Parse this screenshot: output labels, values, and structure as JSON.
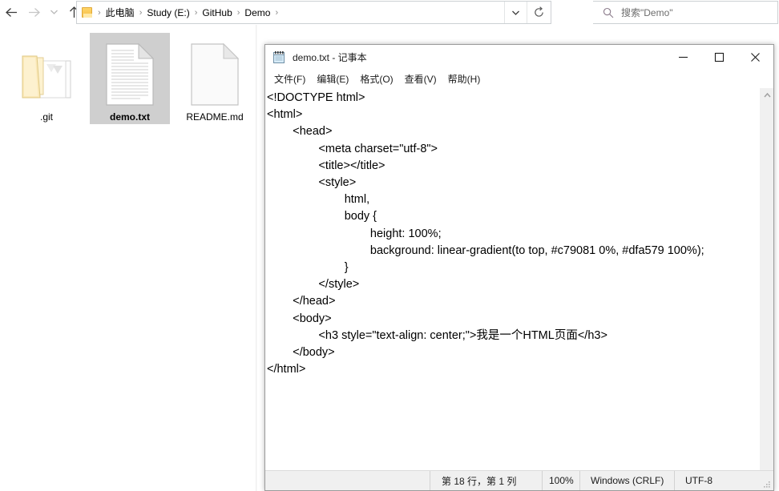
{
  "explorer": {
    "nav": {
      "back_icon": "arrow-left-icon",
      "forward_icon": "arrow-right-icon",
      "recent_icon": "chevron-down-icon",
      "up_icon": "arrow-up-icon"
    },
    "breadcrumb": {
      "folder_icon": "folder-icon",
      "items": [
        "此电脑",
        "Study (E:)",
        "GitHub",
        "Demo"
      ],
      "separator": "›",
      "dropdown_icon": "chevron-down-icon",
      "refresh_icon": "refresh-icon"
    },
    "search": {
      "icon": "search-icon",
      "placeholder": "搜索\"Demo\""
    },
    "files": [
      {
        "name": ".git",
        "icon": "folder-icon",
        "selected": false
      },
      {
        "name": "demo.txt",
        "icon": "text-file-icon",
        "selected": true
      },
      {
        "name": "README.md",
        "icon": "blank-file-icon",
        "selected": false
      }
    ]
  },
  "notepad": {
    "icon": "notepad-icon",
    "title": "demo.txt - 记事本",
    "controls": {
      "minimize": "—",
      "maximize": "☐",
      "close": "✕",
      "minimize_name": "minimize-button",
      "maximize_name": "maximize-button",
      "close_name": "close-button"
    },
    "menu": [
      "文件(F)",
      "编辑(E)",
      "格式(O)",
      "查看(V)",
      "帮助(H)"
    ],
    "document_text": "<!DOCTYPE html>\n<html>\n\t<head>\n\t\t<meta charset=\"utf-8\">\n\t\t<title></title>\n\t\t<style>\n\t\t\thtml,\n\t\t\tbody {\n\t\t\t\theight: 100%;\n\t\t\t\tbackground: linear-gradient(to top, #c79081 0%, #dfa579 100%);\n\t\t\t}\n\t\t</style>\n\t</head>\n\t<body>\n\t\t<h3 style=\"text-align: center;\">我是一个HTML页面</h3>\n\t</body>\n</html>",
    "scrollbar": {
      "up_icon": "chevron-up-icon",
      "down_icon": "chevron-down-icon"
    },
    "statusbar": {
      "position": "第 18 行，第 1 列",
      "zoom": "100%",
      "line_ending": "Windows (CRLF)",
      "encoding": "UTF-8",
      "grip_icon": "resize-grip-icon"
    }
  },
  "colors": {
    "gradient_start": "#c79081",
    "gradient_end": "#dfa579",
    "selection": "#cfcfcf",
    "folder_yellow": "#f5c04b",
    "statusbar_bg": "#f0f0f0"
  }
}
